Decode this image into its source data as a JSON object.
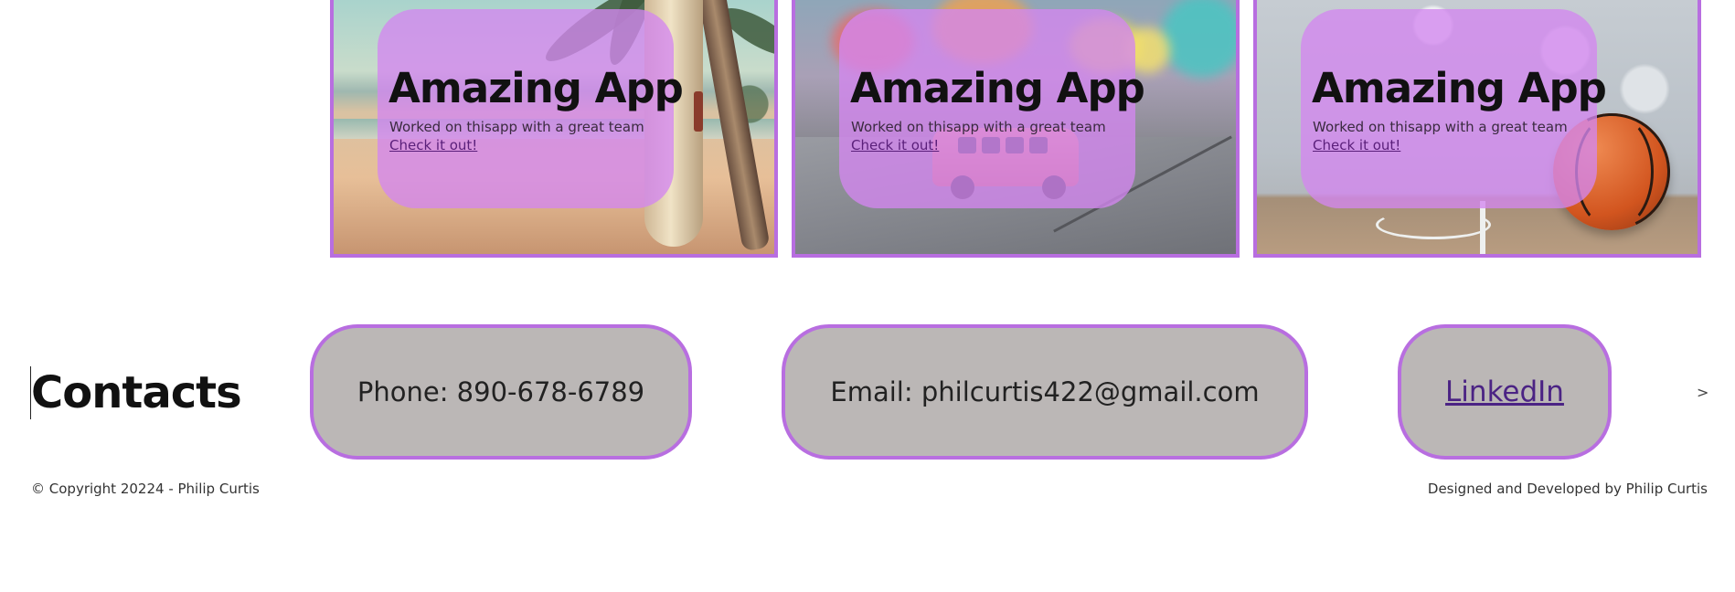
{
  "projects": [
    {
      "title": "Amazing App",
      "description": "Worked on thisapp with a great team",
      "link": "Check it out!",
      "image": "beach-surfboard-photo"
    },
    {
      "title": "Amazing App",
      "description": "Worked on thisapp with a great team",
      "link": "Check it out!",
      "image": "toy-van-street-photo"
    },
    {
      "title": "Amazing App",
      "description": "Worked on thisapp with a great team",
      "link": "Check it out!",
      "image": "basketball-court-photo"
    }
  ],
  "contacts": {
    "heading": "Contacts",
    "phone": "Phone: 890-678-6789",
    "email": "Email: philcurtis422@gmail.com",
    "linkedin": "LinkedIn",
    "more": ">"
  },
  "footer": {
    "copyright": "© Copyright 20224 - Philip Curtis",
    "credit": "Designed and Developed by Philip Curtis"
  },
  "colors": {
    "accent": "#b86ee0",
    "overlay": "#d487f0",
    "pill_background": "#bbb7b6",
    "link": "#4b2384"
  }
}
